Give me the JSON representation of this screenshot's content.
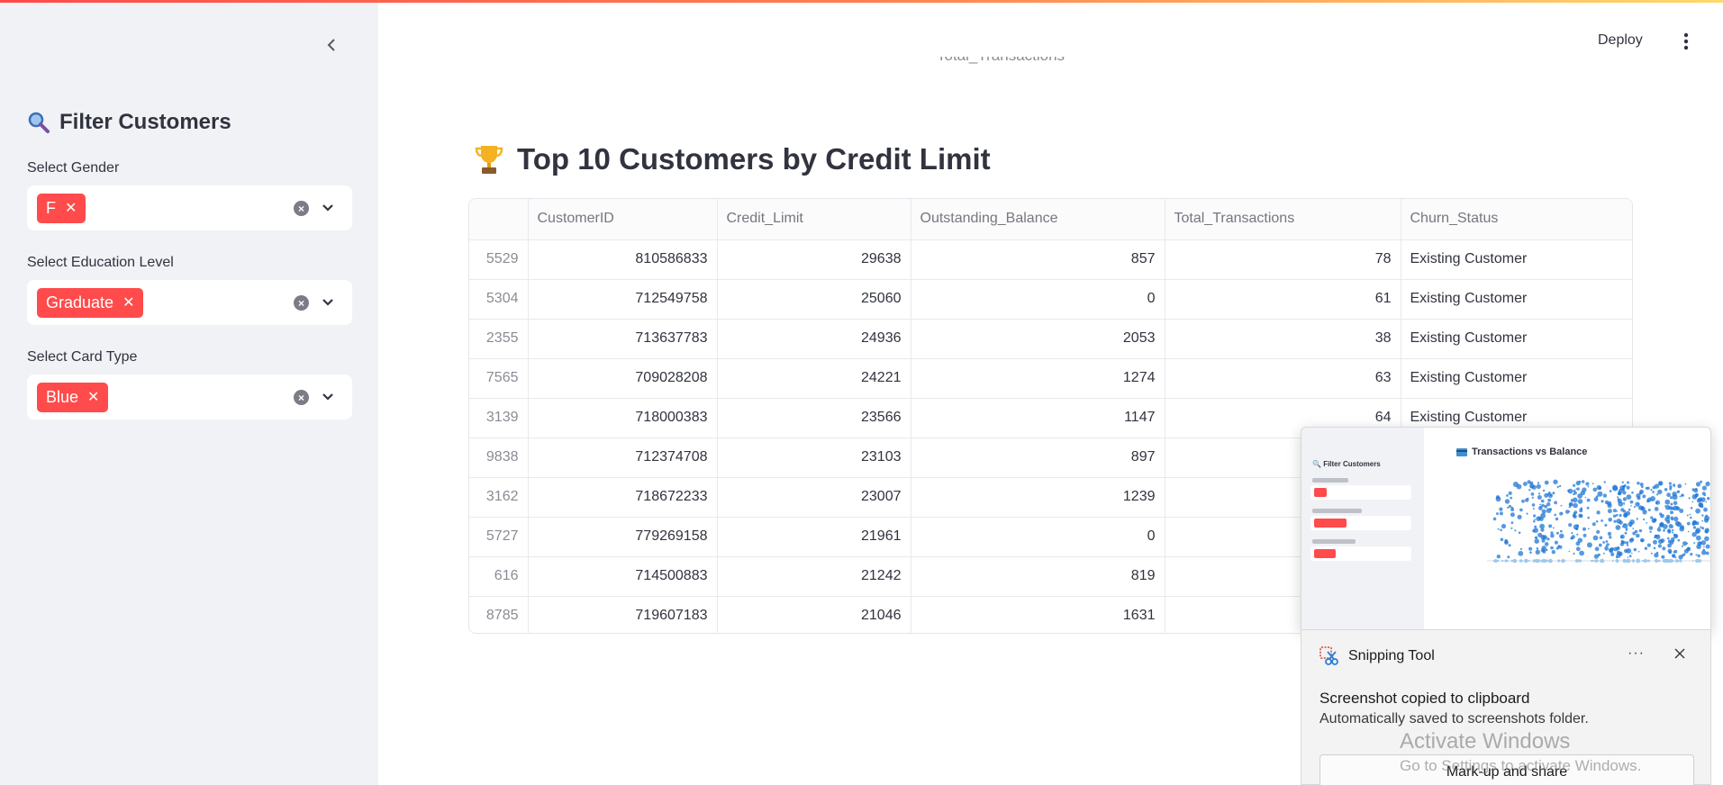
{
  "sidebar": {
    "title": "Filter Customers",
    "filters": [
      {
        "label": "Select Gender",
        "selected": "F"
      },
      {
        "label": "Select Education Level",
        "selected": "Graduate"
      },
      {
        "label": "Select Card Type",
        "selected": "Blue"
      }
    ]
  },
  "header": {
    "deploy_label": "Deploy",
    "clipped_chart_axis_title": "Total_Transactions"
  },
  "main": {
    "heading": "Top 10 Customers by Credit Limit",
    "table": {
      "columns": [
        "",
        "CustomerID",
        "Credit_Limit",
        "Outstanding_Balance",
        "Total_Transactions",
        "Churn_Status"
      ],
      "rows": [
        {
          "index": "5529",
          "customer_id": "810586833",
          "credit_limit": "29638",
          "outstanding_balance": "857",
          "total_transactions": "78",
          "churn_status": "Existing Customer"
        },
        {
          "index": "5304",
          "customer_id": "712549758",
          "credit_limit": "25060",
          "outstanding_balance": "0",
          "total_transactions": "61",
          "churn_status": "Existing Customer"
        },
        {
          "index": "2355",
          "customer_id": "713637783",
          "credit_limit": "24936",
          "outstanding_balance": "2053",
          "total_transactions": "38",
          "churn_status": "Existing Customer"
        },
        {
          "index": "7565",
          "customer_id": "709028208",
          "credit_limit": "24221",
          "outstanding_balance": "1274",
          "total_transactions": "63",
          "churn_status": "Existing Customer"
        },
        {
          "index": "3139",
          "customer_id": "718000383",
          "credit_limit": "23566",
          "outstanding_balance": "1147",
          "total_transactions": "64",
          "churn_status": "Existing Customer"
        },
        {
          "index": "9838",
          "customer_id": "712374708",
          "credit_limit": "23103",
          "outstanding_balance": "897",
          "total_transactions": "",
          "churn_status": ""
        },
        {
          "index": "3162",
          "customer_id": "718672233",
          "credit_limit": "23007",
          "outstanding_balance": "1239",
          "total_transactions": "",
          "churn_status": ""
        },
        {
          "index": "5727",
          "customer_id": "779269158",
          "credit_limit": "21961",
          "outstanding_balance": "0",
          "total_transactions": "",
          "churn_status": ""
        },
        {
          "index": "616",
          "customer_id": "714500883",
          "credit_limit": "21242",
          "outstanding_balance": "819",
          "total_transactions": "",
          "churn_status": ""
        },
        {
          "index": "8785",
          "customer_id": "719607183",
          "credit_limit": "21046",
          "outstanding_balance": "1631",
          "total_transactions": "",
          "churn_status": ""
        }
      ]
    }
  },
  "preview": {
    "sidebar_title": "Filter Customers",
    "chart_title": "Transactions vs Balance"
  },
  "snip": {
    "app_name": "Snipping Tool",
    "message": "Screenshot copied to clipboard",
    "sub": "Automatically saved to screenshots folder.",
    "button_label": "Mark-up and share"
  },
  "watermark": {
    "line1": "Activate Windows",
    "line2": "Go to Settings to activate Windows."
  },
  "colors": {
    "accent": "#ff4b4b",
    "sidebar_bg": "#f0f2f6",
    "text": "#31333f",
    "scatter_point": "#1f77d4"
  },
  "icons": {
    "collapse": "chevron-left-icon",
    "filter_title": "magnifier-icon",
    "heading": "trophy-icon",
    "menu": "kebab-menu-icon",
    "clear": "clear-circle-icon",
    "dropdown": "chevron-down-icon",
    "snip_app": "scissors-icon",
    "snip_close": "close-icon",
    "chart_title": "credit-card-icon"
  }
}
